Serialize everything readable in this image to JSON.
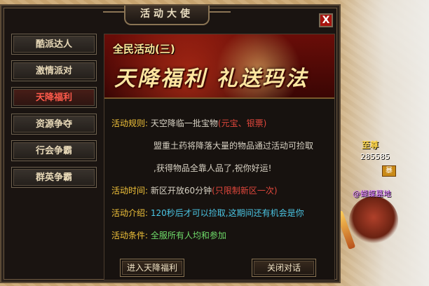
{
  "window": {
    "title": "活动大使",
    "close_label": "X"
  },
  "nav": {
    "items": [
      {
        "label": "酷派达人",
        "active": false
      },
      {
        "label": "激情派对",
        "active": false
      },
      {
        "label": "天降福利",
        "active": true
      },
      {
        "label": "资源争夺",
        "active": false
      },
      {
        "label": "行会争霸",
        "active": false
      },
      {
        "label": "群英争霸",
        "active": false
      }
    ]
  },
  "banner": {
    "subtitle": "全民活动(三)",
    "title": "天降福利 礼送玛法"
  },
  "content": {
    "rules_label": "活动规则:",
    "rules_text_1": "天空降临一批宝物",
    "rules_highlight": "(元宝、银票)",
    "rules_text_2": "盟重土药将降落大量的物品通过活动可捡取",
    "rules_text_3": ",获得物品全靠人品了,祝你好运!",
    "time_label": "活动时间:",
    "time_text": "新区开放60分钟",
    "time_highlight": "(只限制新区一次)",
    "intro_label": "活动介绍:",
    "intro_text": "120秒后才可以捡取,这期间还有机会是你",
    "cond_label": "活动条件:",
    "cond_text": "全服所有人均和参加"
  },
  "buttons": {
    "enter": "进入天降福利",
    "close": "关闭对话"
  },
  "npc": {
    "title": "至尊",
    "id": "285585",
    "badge": "暴",
    "guild": "@蝴蝶墓地"
  }
}
